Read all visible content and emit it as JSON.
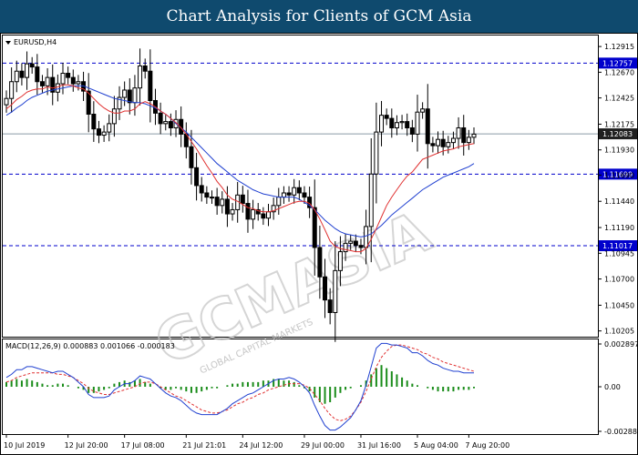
{
  "banner": {
    "title": "Chart Analysis for Clients of GCM Asia"
  },
  "main_panel": {
    "symbol_label": "EURUSD,H4",
    "watermark": "GCMASIA",
    "watermark_sub": "GLOBAL CAPITAL MARKETS"
  },
  "macd_panel": {
    "header": "MACD(12,26,9) 0.000883 0.001066 -0.000183"
  },
  "colors": {
    "banner": "#0f4a6e",
    "level_line": "#0000cc",
    "level_tag": "#0000cc",
    "current_tag": "#202020",
    "ma_fast": "#e03030",
    "ma_slow": "#2040d0",
    "candle": "#000000",
    "macd_hist": "#1a8c1a",
    "macd_signal": "#e03030",
    "macd_line": "#2040d0"
  },
  "chart_data": [
    {
      "type": "candlestick",
      "symbol": "EURUSD",
      "timeframe": "H4",
      "ylim": [
        1.1015,
        1.1302
      ],
      "y_ticks": [
        "1.12915",
        "1.12670",
        "1.12425",
        "1.12175",
        "1.11930",
        "1.11690",
        "1.11440",
        "1.11190",
        "1.10945",
        "1.10700",
        "1.10450",
        "1.10205"
      ],
      "x_ticks": [
        "10 Jul 2019",
        "12 Jul 20:00",
        "17 Jul 08:00",
        "21 Jul 21:01",
        "24 Jul 12:00",
        "29 Jul 00:00",
        "31 Jul 16:00",
        "5 Aug 04:00",
        "7 Aug 20:00"
      ],
      "levels": [
        "1.12757",
        "1.11699",
        "1.11017"
      ],
      "current_price": "1.12083",
      "close": [
        1.1242,
        1.1258,
        1.1268,
        1.1262,
        1.1275,
        1.1272,
        1.1258,
        1.1254,
        1.1262,
        1.1248,
        1.1256,
        1.1266,
        1.1262,
        1.1256,
        1.1258,
        1.1249,
        1.1227,
        1.1213,
        1.1207,
        1.121,
        1.1218,
        1.1232,
        1.1243,
        1.125,
        1.1238,
        1.1252,
        1.1273,
        1.1268,
        1.124,
        1.1228,
        1.1218,
        1.122,
        1.1214,
        1.1222,
        1.1208,
        1.1196,
        1.1176,
        1.1159,
        1.1152,
        1.1148,
        1.1148,
        1.114,
        1.1146,
        1.1132,
        1.1136,
        1.115,
        1.1142,
        1.1127,
        1.1136,
        1.1132,
        1.1128,
        1.1134,
        1.114,
        1.1148,
        1.1152,
        1.115,
        1.1157,
        1.1152,
        1.1148,
        1.1138,
        1.11,
        1.1072,
        1.105,
        1.1038,
        1.1078,
        1.1096,
        1.1104,
        1.1106,
        1.1102,
        1.11,
        1.112,
        1.117,
        1.121,
        1.1226,
        1.1223,
        1.1214,
        1.1219,
        1.122,
        1.1214,
        1.1208,
        1.1229,
        1.1232,
        1.1199,
        1.1197,
        1.1203,
        1.1196,
        1.12,
        1.1204,
        1.1214,
        1.12,
        1.1205,
        1.1208
      ],
      "ma_fast": [
        1.1232,
        1.1236,
        1.1241,
        1.1244,
        1.1248,
        1.125,
        1.1251,
        1.1251,
        1.1253,
        1.1252,
        1.1253,
        1.1255,
        1.1255,
        1.1254,
        1.1252,
        1.1251,
        1.1247,
        1.1242,
        1.1237,
        1.1233,
        1.123,
        1.1228,
        1.1228,
        1.123,
        1.123,
        1.1232,
        1.1237,
        1.1239,
        1.1237,
        1.1234,
        1.123,
        1.1227,
        1.1223,
        1.1219,
        1.1214,
        1.1208,
        1.1201,
        1.1194,
        1.1186,
        1.1178,
        1.1171,
        1.1163,
        1.1157,
        1.115,
        1.1146,
        1.1144,
        1.1141,
        1.1138,
        1.1137,
        1.1135,
        1.1134,
        1.1134,
        1.1135,
        1.1137,
        1.1139,
        1.1141,
        1.1143,
        1.1144,
        1.1144,
        1.1142,
        1.1136,
        1.1127,
        1.1117,
        1.1106,
        1.1101,
        1.1099,
        1.1098,
        1.1097,
        1.1096,
        1.1096,
        1.1099,
        1.1108,
        1.1118,
        1.1129,
        1.114,
        1.1148,
        1.1155,
        1.1162,
        1.1168,
        1.1172,
        1.1178,
        1.1184,
        1.1186,
        1.1188,
        1.119,
        1.1192,
        1.1193,
        1.1194,
        1.1196,
        1.1197,
        1.1198,
        1.1199
      ],
      "ma_slow": [
        1.1226,
        1.1229,
        1.1233,
        1.1236,
        1.124,
        1.1243,
        1.1245,
        1.1247,
        1.1249,
        1.125,
        1.1251,
        1.1252,
        1.1253,
        1.1254,
        1.1254,
        1.1254,
        1.1252,
        1.125,
        1.1248,
        1.1246,
        1.1244,
        1.1242,
        1.1241,
        1.124,
        1.1239,
        1.1238,
        1.1238,
        1.1237,
        1.1235,
        1.1233,
        1.123,
        1.1227,
        1.1223,
        1.1218,
        1.1214,
        1.121,
        1.1205,
        1.12,
        1.1195,
        1.119,
        1.1185,
        1.118,
        1.1176,
        1.1172,
        1.1168,
        1.1164,
        1.1161,
        1.1158,
        1.1155,
        1.1153,
        1.1151,
        1.115,
        1.1149,
        1.1148,
        1.1148,
        1.1148,
        1.1148,
        1.1146,
        1.1143,
        1.114,
        1.1136,
        1.1131,
        1.1126,
        1.1122,
        1.1118,
        1.1115,
        1.1113,
        1.1112,
        1.1111,
        1.111,
        1.1111,
        1.1113,
        1.1117,
        1.1121,
        1.1126,
        1.1131,
        1.1135,
        1.1139,
        1.1143,
        1.1147,
        1.1151,
        1.1155,
        1.1158,
        1.1161,
        1.1164,
        1.1167,
        1.1169,
        1.1171,
        1.1173,
        1.1175,
        1.1177,
        1.118
      ]
    },
    {
      "type": "macd",
      "header": "MACD(12,26,9) 0.000883 0.001066 -0.000183",
      "ylim": [
        -0.003,
        0.003
      ],
      "y_ticks": [
        "0.002897",
        "0.00",
        "-0.002883"
      ],
      "histogram": [
        0.0003,
        0.0004,
        0.0005,
        0.0004,
        0.0005,
        0.0004,
        0.0003,
        0.0002,
        0.0001,
        0.0001,
        0.0002,
        0.0002,
        0.0001,
        0.0,
        -0.0001,
        -0.0002,
        -0.0004,
        -0.0004,
        -0.0003,
        -0.0002,
        -0.0001,
        0.0002,
        0.0003,
        0.0004,
        0.0003,
        0.0004,
        0.0005,
        0.0003,
        0.0002,
        0.0,
        -0.0001,
        -0.0002,
        -0.0002,
        -0.0001,
        -0.0002,
        -0.0003,
        -0.0004,
        -0.0004,
        -0.0003,
        -0.0002,
        -0.0001,
        -0.0001,
        0.0,
        0.0001,
        0.0002,
        0.0002,
        0.0003,
        0.0003,
        0.0003,
        0.0003,
        0.0004,
        0.0004,
        0.0005,
        0.0005,
        0.0004,
        0.0004,
        0.0003,
        0.0001,
        -0.0001,
        -0.0003,
        -0.0007,
        -0.001,
        -0.0011,
        -0.001,
        -0.0007,
        -0.0004,
        -0.0002,
        -0.0001,
        0.0,
        0.0001,
        0.0004,
        0.0008,
        0.0012,
        0.0014,
        0.0012,
        0.001,
        0.0008,
        0.0006,
        0.0004,
        0.0002,
        0.0001,
        0.0,
        -0.0001,
        -0.0002,
        -0.0003,
        -0.0003,
        -0.0003,
        -0.0003,
        -0.0002,
        -0.0002,
        -0.0002,
        -0.0001
      ],
      "signal": [
        0.0003,
        0.0004,
        0.0006,
        0.0007,
        0.0008,
        0.0009,
        0.0009,
        0.0009,
        0.0009,
        0.0009,
        0.0008,
        0.0008,
        0.0007,
        0.0006,
        0.0004,
        0.0002,
        -0.0001,
        -0.0003,
        -0.0004,
        -0.0005,
        -0.0005,
        -0.0004,
        -0.0003,
        -0.0002,
        -0.0001,
        0.0,
        0.0002,
        0.0003,
        0.0003,
        0.0002,
        0.0,
        -0.0002,
        -0.0004,
        -0.0006,
        -0.0007,
        -0.0009,
        -0.0011,
        -0.0013,
        -0.0015,
        -0.0016,
        -0.0017,
        -0.0017,
        -0.0016,
        -0.0015,
        -0.0013,
        -0.0011,
        -0.001,
        -0.0008,
        -0.0007,
        -0.0005,
        -0.0004,
        -0.0002,
        -0.0001,
        0.0,
        0.0001,
        0.0002,
        0.0002,
        0.0002,
        0.0001,
        -0.0001,
        -0.0005,
        -0.0009,
        -0.0014,
        -0.0018,
        -0.0021,
        -0.0022,
        -0.0021,
        -0.0019,
        -0.0015,
        -0.001,
        -0.0003,
        0.0005,
        0.0013,
        0.0019,
        0.0023,
        0.0026,
        0.0027,
        0.0027,
        0.0026,
        0.0025,
        0.0024,
        0.0022,
        0.0021,
        0.0019,
        0.0018,
        0.0016,
        0.0015,
        0.0014,
        0.0013,
        0.0012,
        0.0011,
        0.001
      ],
      "macd": [
        0.0006,
        0.0008,
        0.0011,
        0.0011,
        0.0013,
        0.0013,
        0.0012,
        0.0011,
        0.001,
        0.0009,
        0.001,
        0.001,
        0.0008,
        0.0006,
        0.0003,
        0.0,
        -0.0005,
        -0.0007,
        -0.0007,
        -0.0007,
        -0.0006,
        -0.0002,
        0.0,
        0.0002,
        0.0002,
        0.0004,
        0.0007,
        0.0006,
        0.0005,
        0.0002,
        -0.0001,
        -0.0004,
        -0.0006,
        -0.0007,
        -0.0009,
        -0.0012,
        -0.0015,
        -0.0017,
        -0.0018,
        -0.0018,
        -0.0018,
        -0.0018,
        -0.0016,
        -0.0014,
        -0.0011,
        -0.0009,
        -0.0007,
        -0.0005,
        -0.0004,
        -0.0002,
        0.0,
        0.0002,
        0.0004,
        0.0005,
        0.0005,
        0.0006,
        0.0005,
        0.0003,
        0.0,
        -0.0004,
        -0.0012,
        -0.0019,
        -0.0025,
        -0.0028,
        -0.0028,
        -0.0026,
        -0.0023,
        -0.002,
        -0.0015,
        -0.0009,
        0.0001,
        0.0013,
        0.0025,
        0.0028,
        0.0028,
        0.0027,
        0.0027,
        0.0026,
        0.0025,
        0.0022,
        0.0022,
        0.002,
        0.0017,
        0.0015,
        0.0014,
        0.0012,
        0.0011,
        0.001,
        0.001,
        0.0009,
        0.0009,
        0.0009
      ]
    }
  ]
}
